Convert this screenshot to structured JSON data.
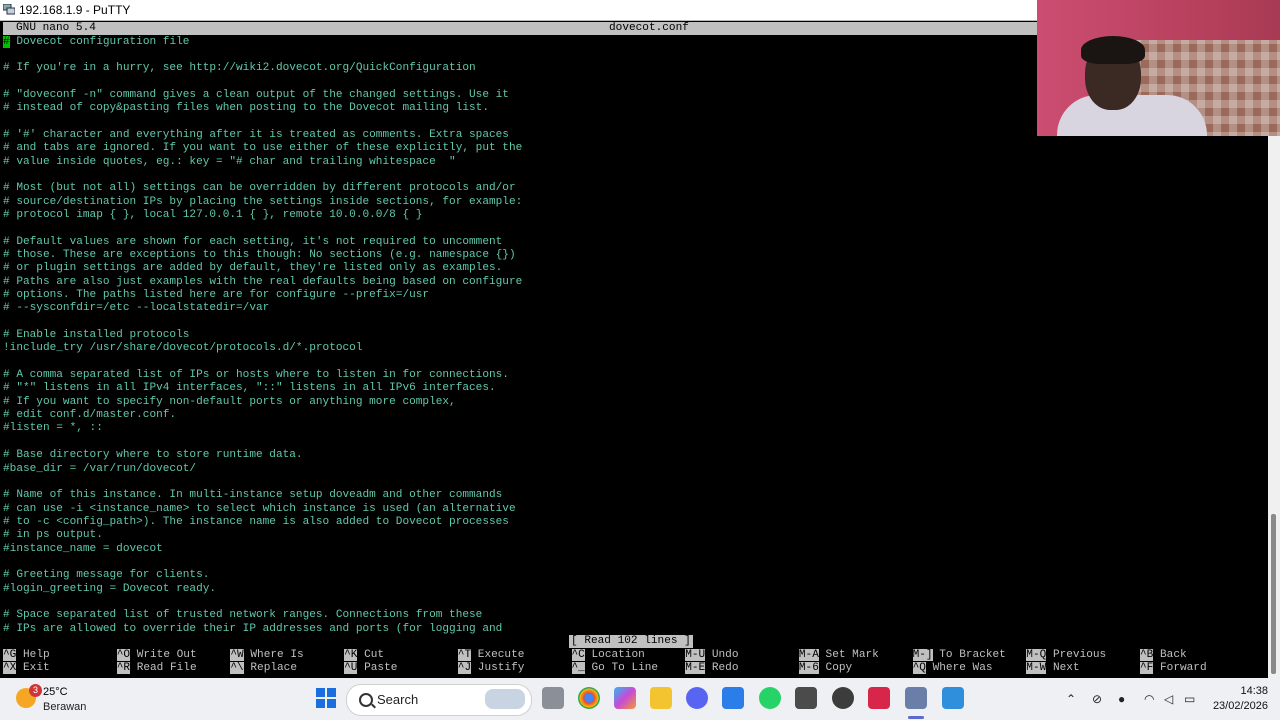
{
  "window": {
    "title": "192.168.1.9 - PuTTY"
  },
  "nano": {
    "version": "GNU nano 5.4",
    "filename": "dovecot.conf",
    "status_message": "[ Read 102 lines ]",
    "lines": [
      "# Dovecot configuration file",
      "",
      "# If you're in a hurry, see http://wiki2.dovecot.org/QuickConfiguration",
      "",
      "# \"doveconf -n\" command gives a clean output of the changed settings. Use it",
      "# instead of copy&pasting files when posting to the Dovecot mailing list.",
      "",
      "# '#' character and everything after it is treated as comments. Extra spaces",
      "# and tabs are ignored. If you want to use either of these explicitly, put the",
      "# value inside quotes, eg.: key = \"# char and trailing whitespace  \"",
      "",
      "# Most (but not all) settings can be overridden by different protocols and/or",
      "# source/destination IPs by placing the settings inside sections, for example:",
      "# protocol imap { }, local 127.0.0.1 { }, remote 10.0.0.0/8 { }",
      "",
      "# Default values are shown for each setting, it's not required to uncomment",
      "# those. These are exceptions to this though: No sections (e.g. namespace {})",
      "# or plugin settings are added by default, they're listed only as examples.",
      "# Paths are also just examples with the real defaults being based on configure",
      "# options. The paths listed here are for configure --prefix=/usr",
      "# --sysconfdir=/etc --localstatedir=/var",
      "",
      "# Enable installed protocols",
      "!include_try /usr/share/dovecot/protocols.d/*.protocol",
      "",
      "# A comma separated list of IPs or hosts where to listen in for connections.",
      "# \"*\" listens in all IPv4 interfaces, \"::\" listens in all IPv6 interfaces.",
      "# If you want to specify non-default ports or anything more complex,",
      "# edit conf.d/master.conf.",
      "#listen = *, ::",
      "",
      "# Base directory where to store runtime data.",
      "#base_dir = /var/run/dovecot/",
      "",
      "# Name of this instance. In multi-instance setup doveadm and other commands",
      "# can use -i <instance_name> to select which instance is used (an alternative",
      "# to -c <config_path>). The instance name is also added to Dovecot processes",
      "# in ps output.",
      "#instance_name = dovecot",
      "",
      "# Greeting message for clients.",
      "#login_greeting = Dovecot ready.",
      "",
      "# Space separated list of trusted network ranges. Connections from these",
      "# IPs are allowed to override their IP addresses and ports (for logging and"
    ],
    "shortcuts": [
      {
        "key": "^G",
        "label": "Help"
      },
      {
        "key": "^X",
        "label": "Exit"
      },
      {
        "key": "^O",
        "label": "Write Out"
      },
      {
        "key": "^R",
        "label": "Read File"
      },
      {
        "key": "^W",
        "label": "Where Is"
      },
      {
        "key": "^\\",
        "label": "Replace"
      },
      {
        "key": "^K",
        "label": "Cut"
      },
      {
        "key": "^U",
        "label": "Paste"
      },
      {
        "key": "^T",
        "label": "Execute"
      },
      {
        "key": "^J",
        "label": "Justify"
      },
      {
        "key": "^C",
        "label": "Location"
      },
      {
        "key": "^_",
        "label": "Go To Line"
      },
      {
        "key": "M-U",
        "label": "Undo"
      },
      {
        "key": "M-E",
        "label": "Redo"
      },
      {
        "key": "M-A",
        "label": "Set Mark"
      },
      {
        "key": "M-6",
        "label": "Copy"
      },
      {
        "key": "M-]",
        "label": "To Bracket"
      },
      {
        "key": "^Q",
        "label": "Where Was"
      },
      {
        "key": "M-Q",
        "label": "Previous"
      },
      {
        "key": "M-W",
        "label": "Next"
      },
      {
        "key": "^B",
        "label": "Back"
      },
      {
        "key": "^F",
        "label": "Forward"
      }
    ]
  },
  "taskbar": {
    "weather": {
      "temperature": "25°C",
      "condition": "Berawan",
      "badge": "3"
    },
    "search_label": "Search",
    "clock": {
      "time": "14:38",
      "date": "23/02/2026"
    },
    "apps": [
      "file-explorer",
      "chrome",
      "copilot",
      "files",
      "discord",
      "store",
      "whatsapp",
      "tools",
      "clock-app",
      "camera",
      "putty",
      "notepad"
    ]
  },
  "colors": {
    "terminal_text": "#60c8ac",
    "terminal_bg": "#000000",
    "nano_bar": "#c0c0c0",
    "cursor": "#00c000"
  }
}
